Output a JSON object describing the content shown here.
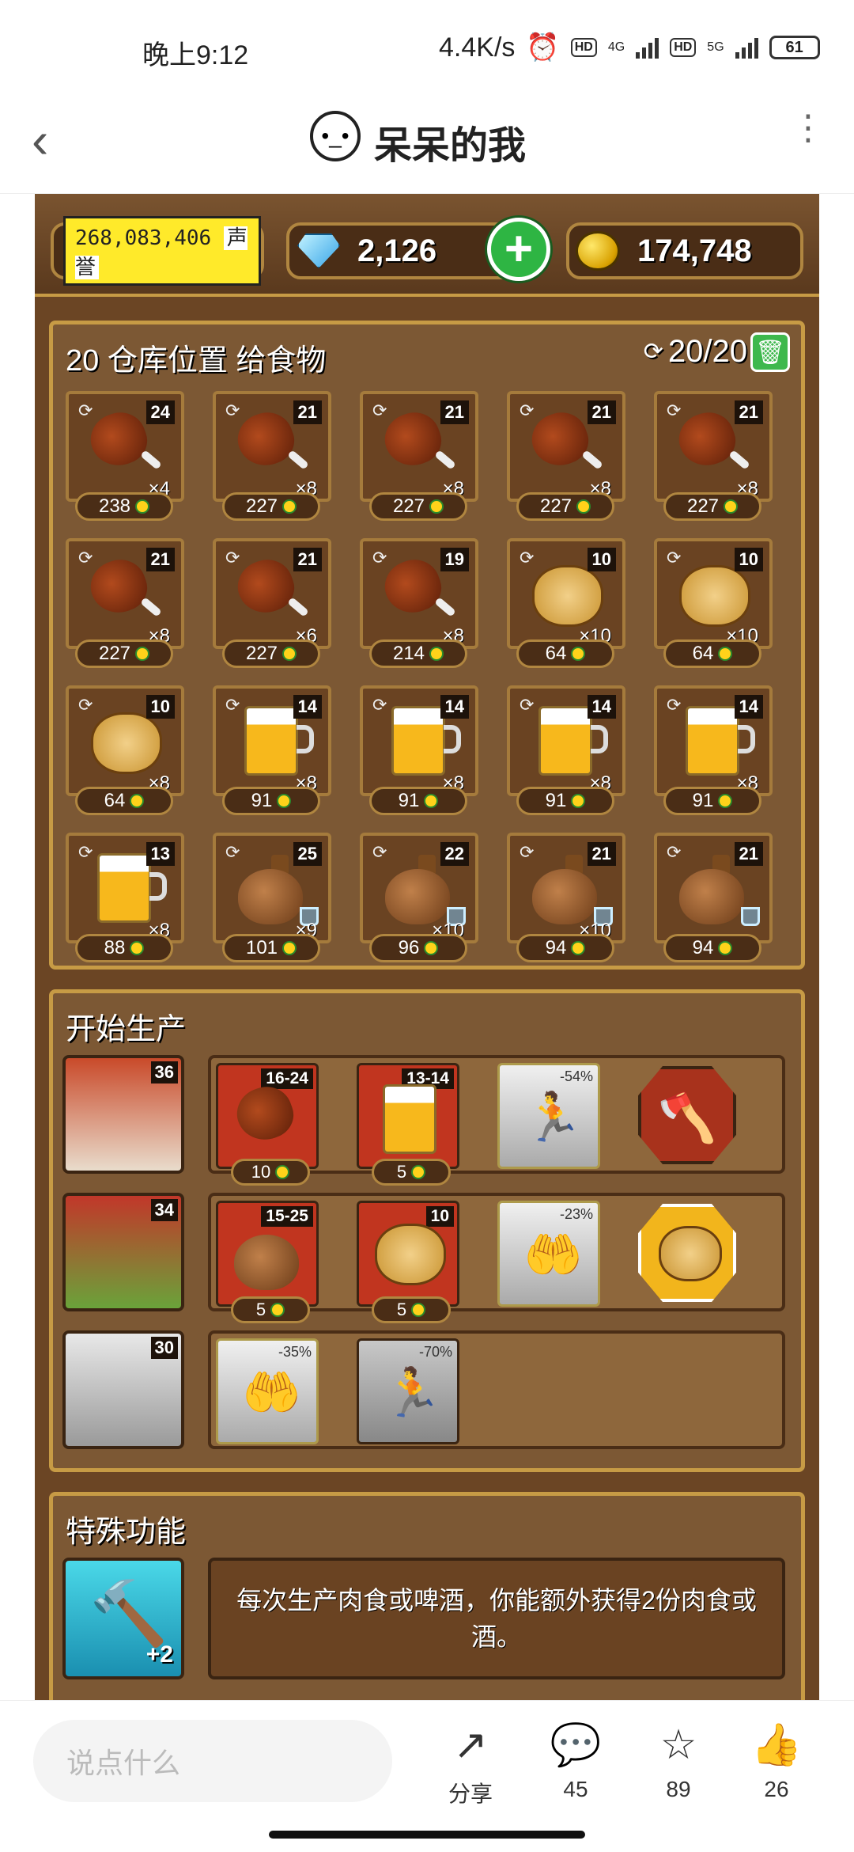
{
  "status_bar": {
    "time": "晚上9:12",
    "speed": "4.4K/s",
    "net1": "4G",
    "net2": "5G",
    "hd": "HD",
    "battery": "61"
  },
  "header": {
    "title": "呆呆的我",
    "back_icon": "chevron-left-icon",
    "more_icon": "more-vertical-icon"
  },
  "game": {
    "reputation": "268,083,406",
    "reputation_label": "声誉",
    "gems": "2,126",
    "coins": "174,748",
    "storage": {
      "title": "20 仓库位置 给食物",
      "counter": "20/20",
      "slots": [
        {
          "item": "meat",
          "level": "24",
          "qty": "×4",
          "price": "238"
        },
        {
          "item": "meat",
          "level": "21",
          "qty": "×8",
          "price": "227"
        },
        {
          "item": "meat",
          "level": "21",
          "qty": "×8",
          "price": "227"
        },
        {
          "item": "meat",
          "level": "21",
          "qty": "×8",
          "price": "227"
        },
        {
          "item": "meat",
          "level": "21",
          "qty": "×8",
          "price": "227"
        },
        {
          "item": "meat",
          "level": "21",
          "qty": "×8",
          "price": "227"
        },
        {
          "item": "meat",
          "level": "21",
          "qty": "×6",
          "price": "227"
        },
        {
          "item": "meat",
          "level": "19",
          "qty": "×8",
          "price": "214"
        },
        {
          "item": "cookie",
          "level": "10",
          "qty": "×10",
          "price": "64"
        },
        {
          "item": "cookie",
          "level": "10",
          "qty": "×10",
          "price": "64"
        },
        {
          "item": "cookie",
          "level": "10",
          "qty": "×8",
          "price": "64"
        },
        {
          "item": "beer",
          "level": "14",
          "qty": "×8",
          "price": "91"
        },
        {
          "item": "beer",
          "level": "14",
          "qty": "×8",
          "price": "91"
        },
        {
          "item": "beer",
          "level": "14",
          "qty": "×8",
          "price": "91"
        },
        {
          "item": "beer",
          "level": "14",
          "qty": "×8",
          "price": "91"
        },
        {
          "item": "beer",
          "level": "13",
          "qty": "×8",
          "price": "88"
        },
        {
          "item": "flask",
          "level": "25",
          "qty": "×9",
          "price": "101"
        },
        {
          "item": "flask",
          "level": "22",
          "qty": "×10",
          "price": "96"
        },
        {
          "item": "flask",
          "level": "21",
          "qty": "×10",
          "price": "94"
        },
        {
          "item": "flask",
          "level": "21",
          "qty": "",
          "price": "94"
        }
      ]
    },
    "production": {
      "title": "开始生产",
      "rows": [
        {
          "char_level": "36",
          "tile1_range": "16-24",
          "tile1_price": "10",
          "tile2_range": "13-14",
          "tile2_price": "5",
          "boost_pct": "-54%"
        },
        {
          "char_level": "34",
          "tile1_range": "15-25",
          "tile1_price": "5",
          "tile2_range": "10",
          "tile2_price": "5",
          "boost_pct": "-23%"
        },
        {
          "char_level": "30",
          "boost1_pct": "-35%",
          "boost2_pct": "-70%"
        }
      ]
    },
    "special": {
      "title": "特殊功能",
      "badge": "+2",
      "description": "每次生产肉食或啤酒，你能额外获得2份肉食或酒。"
    }
  },
  "bottom": {
    "placeholder": "说点什么",
    "share_label": "分享",
    "comments": "45",
    "favorites": "89",
    "likes": "26"
  }
}
